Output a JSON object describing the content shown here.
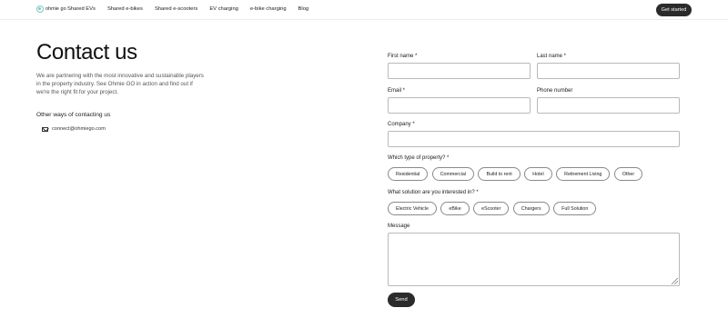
{
  "header": {
    "logo_text": "ohmie go",
    "nav": [
      "Shared EVs",
      "Shared e-bikes",
      "Shared e-scooters",
      "EV charging",
      "e-bike charging",
      "Blog"
    ],
    "cta_label": "Get started"
  },
  "left": {
    "title": "Contact us",
    "intro": "We are partnering with the most innovative and sustainable players in the property industry. See Ohmie GO in action and find out if we're the right fit for your project.",
    "other_title": "Other ways of contacting us",
    "email": "connect@ohmiego.com"
  },
  "form": {
    "first_name_label": "First name *",
    "first_name_value": "",
    "last_name_label": "Last name *",
    "last_name_value": "",
    "email_label": "Email *",
    "email_value": "",
    "phone_label": "Phone number",
    "phone_value": "",
    "company_label": "Company *",
    "company_value": "",
    "property_label": "Which type of property? *",
    "property_options": [
      "Residential",
      "Commercial",
      "Build to rent",
      "Hotel",
      "Retirement Living",
      "Other"
    ],
    "solution_label": "What solution are you interested in? *",
    "solution_options": [
      "Electric Vehicle",
      "eBike",
      "eScooter",
      "Chargers",
      "Full Solution"
    ],
    "message_label": "Message",
    "send_label": "Send"
  }
}
